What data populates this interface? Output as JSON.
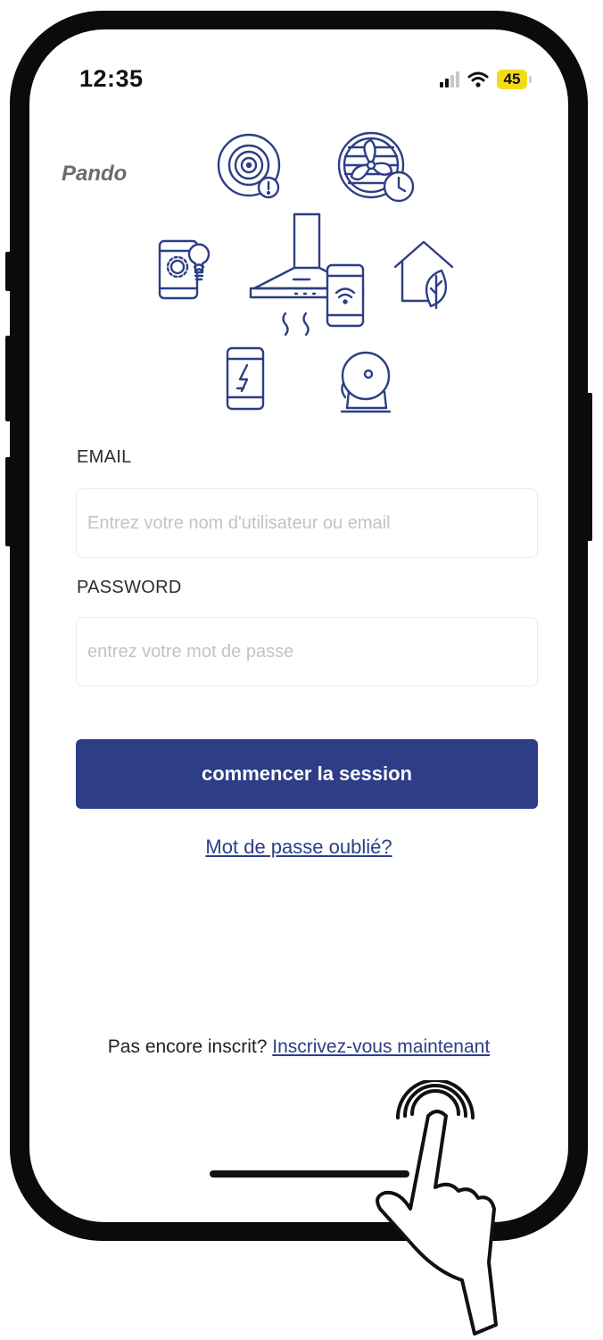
{
  "status_bar": {
    "time": "12:35",
    "battery": "45"
  },
  "brand": {
    "name": "Pando"
  },
  "illustration_icons": [
    "smoke-detector-icon",
    "fan-timer-icon",
    "tablet-bulb-icon",
    "range-hood-icon",
    "smartphone-wifi-icon",
    "eco-home-icon",
    "phone-charging-icon",
    "bell-icon"
  ],
  "form": {
    "email_label": "EMAIL",
    "email_placeholder": "Entrez votre nom d'utilisateur ou email",
    "email_value": "",
    "password_label": "PASSWORD",
    "password_placeholder": "entrez votre mot de passe",
    "password_value": "",
    "submit_label": "commencer la session",
    "forgot_label": "Mot de passe oublié?"
  },
  "signup": {
    "prompt": "Pas encore inscrit?",
    "link_label": "Inscrivez-vous maintenant"
  },
  "colors": {
    "primary": "#2d3e86",
    "icon_stroke": "#2d3e86",
    "battery": "#f2dc1a",
    "brand": "#6b6b6b"
  }
}
